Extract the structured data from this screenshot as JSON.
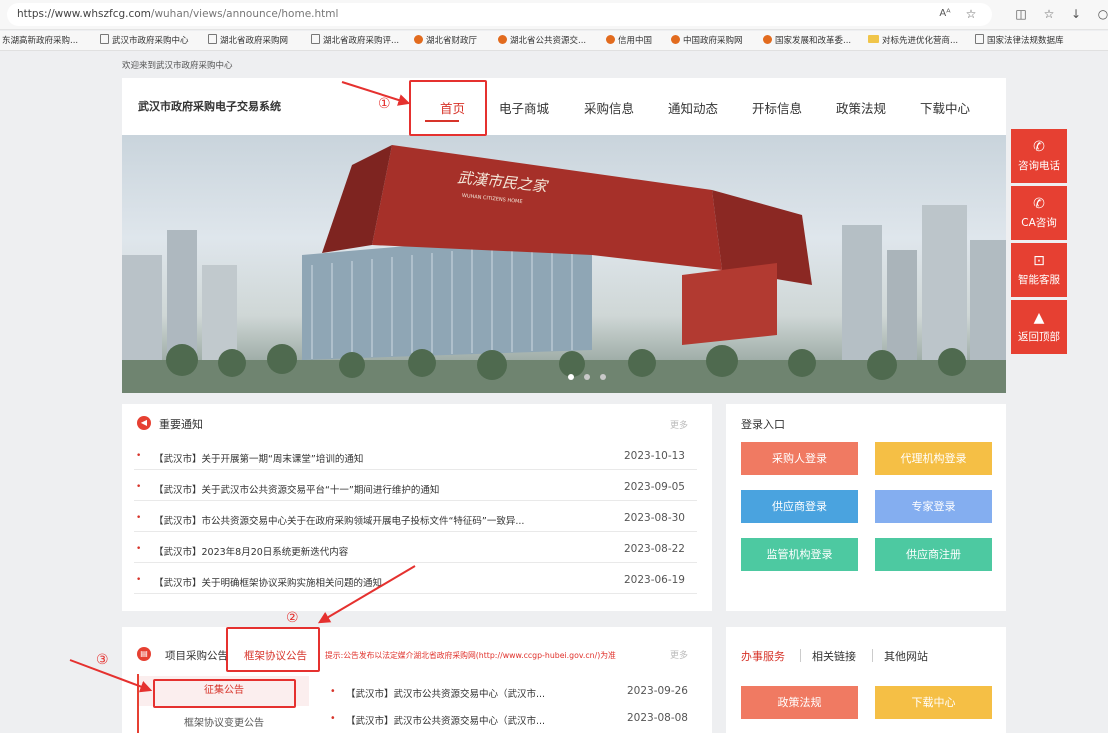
{
  "browser": {
    "url_host": "https://www.whszfcg.com",
    "url_path": "/wuhan/views/announce/home.html",
    "reader_label": "Aᴬ",
    "bookmarks": [
      {
        "label": "东湖高新政府采购...",
        "icon": "none"
      },
      {
        "label": "武汉市政府采购中心",
        "icon": "page"
      },
      {
        "label": "湖北省政府采购网",
        "icon": "page"
      },
      {
        "label": "湖北省政府采购评...",
        "icon": "page"
      },
      {
        "label": "湖北省财政厅",
        "icon": "orange"
      },
      {
        "label": "湖北省公共资源交...",
        "icon": "orange"
      },
      {
        "label": "信用中国",
        "icon": "orange"
      },
      {
        "label": "中国政府采购网",
        "icon": "orange"
      },
      {
        "label": "国家发展和改革委...",
        "icon": "orange"
      },
      {
        "label": "对标先进优化营商...",
        "icon": "folder"
      },
      {
        "label": "国家法律法规数据库",
        "icon": "page"
      }
    ]
  },
  "site": {
    "welcome": "欢迎来到武汉市政府采购中心",
    "name": "武汉市政府采购电子交易系统",
    "nav": [
      "首页",
      "电子商城",
      "采购信息",
      "通知动态",
      "开标信息",
      "政策法规",
      "下载中心"
    ],
    "banner_sign": "武漢市民之家",
    "banner_sign_en": "WUHAN CITIZENS HOME"
  },
  "float_menu": [
    {
      "icon": "phone-icon",
      "label": "咨询电话",
      "glyph": "✆"
    },
    {
      "icon": "phone-icon",
      "label": "CA咨询",
      "glyph": "✆"
    },
    {
      "icon": "chat-icon",
      "label": "智能客服",
      "glyph": "⊡"
    },
    {
      "icon": "arrow-up-icon",
      "label": "返回顶部",
      "glyph": "▲"
    }
  ],
  "notice": {
    "title": "重要通知",
    "more": "更多",
    "items": [
      {
        "title": "【武汉市】关于开展第一期“周末课堂”培训的通知",
        "date": "2023-10-13"
      },
      {
        "title": "【武汉市】关于武汉市公共资源交易平台“十一”期间进行维护的通知",
        "date": "2023-09-05"
      },
      {
        "title": "【武汉市】市公共资源交易中心关于在政府采购领域开展电子投标文件“特征码”一致异...",
        "date": "2023-08-30"
      },
      {
        "title": "【武汉市】2023年8月20日系统更新迭代内容",
        "date": "2023-08-22"
      },
      {
        "title": "【武汉市】关于明确框架协议采购实施相关问题的通知",
        "date": "2023-06-19"
      }
    ]
  },
  "login": {
    "title": "登录入口",
    "buttons": [
      {
        "label": "采购人登录",
        "color": "#f07a62"
      },
      {
        "label": "代理机构登录",
        "color": "#f5bf45"
      },
      {
        "label": "供应商登录",
        "color": "#4aa3df"
      },
      {
        "label": "专家登录",
        "color": "#84aef0"
      },
      {
        "label": "监管机构登录",
        "color": "#4dc9a1"
      },
      {
        "label": "供应商注册",
        "color": "#4dc9a1"
      }
    ]
  },
  "project": {
    "tab1": "项目采购公告",
    "tab2": "框架协议公告",
    "tip": "提示:公告发布以法定媒介湖北省政府采购网(http://www.ccgp-hubei.gov.cn/)为准",
    "more": "更多",
    "subtabs": [
      "征集公告",
      "框架协议变更公告"
    ],
    "items": [
      {
        "title": "【武汉市】武汉市公共资源交易中心（武汉市...",
        "date": "2023-09-26"
      },
      {
        "title": "【武汉市】武汉市公共资源交易中心（武汉市...",
        "date": "2023-08-08"
      }
    ]
  },
  "office": {
    "tabs": [
      "办事服务",
      "相关链接",
      "其他网站"
    ],
    "buttons": [
      {
        "label": "政策法规",
        "color": "#f07a62"
      },
      {
        "label": "下载中心",
        "color": "#f5bf45"
      }
    ]
  },
  "annotations": [
    "①",
    "②",
    "③"
  ],
  "colors": {
    "accent": "#e64032",
    "annotation": "#e5312f"
  }
}
